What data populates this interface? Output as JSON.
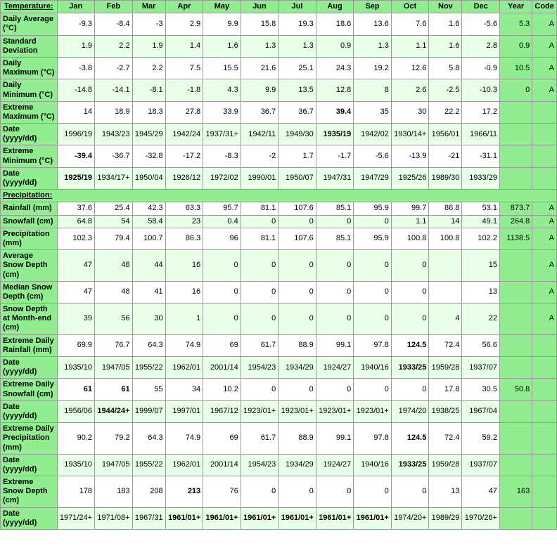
{
  "headers": {
    "label": "Temperature:",
    "cols": [
      "Jan",
      "Feb",
      "Mar",
      "Apr",
      "May",
      "Jun",
      "Jul",
      "Aug",
      "Sep",
      "Oct",
      "Nov",
      "Dec",
      "Year",
      "Code"
    ]
  },
  "rows": [
    {
      "label": "Daily Average (°C)",
      "values": [
        "-9.3",
        "-8.4",
        "-3",
        "2.9",
        "9.9",
        "15.8",
        "19.3",
        "18.6",
        "13.6",
        "7.6",
        "1.6",
        "-5.6",
        "5.3",
        "A"
      ],
      "bolds": []
    },
    {
      "label": "Standard Deviation",
      "values": [
        "1.9",
        "2.2",
        "1.9",
        "1.4",
        "1.6",
        "1.3",
        "1.3",
        "0.9",
        "1.3",
        "1.1",
        "1.6",
        "2.8",
        "0.9",
        "A"
      ],
      "bolds": []
    },
    {
      "label": "Daily Maximum (°C)",
      "values": [
        "-3.8",
        "-2.7",
        "2.2",
        "7.5",
        "15.5",
        "21.6",
        "25.1",
        "24.3",
        "19.2",
        "12.6",
        "5.8",
        "-0.9",
        "10.5",
        "A"
      ],
      "bolds": []
    },
    {
      "label": "Daily Minimum (°C)",
      "values": [
        "-14.8",
        "-14.1",
        "-8.1",
        "-1.8",
        "4.3",
        "9.9",
        "13.5",
        "12.8",
        "8",
        "2.6",
        "-2.5",
        "-10.3",
        "0",
        "A"
      ],
      "bolds": []
    },
    {
      "label": "Extreme Maximum (°C)",
      "values": [
        "14",
        "18.9",
        "18.3",
        "27.8",
        "33.9",
        "36.7",
        "36.7",
        "39.4",
        "35",
        "30",
        "22.2",
        "17.2",
        "",
        ""
      ],
      "bolds": [
        "39.4"
      ]
    },
    {
      "label": "Date (yyyy/dd)",
      "values": [
        "1996/19",
        "1943/23",
        "1945/29",
        "1942/24",
        "1937/31+",
        "1942/11",
        "1949/30",
        "1935/19",
        "1942/02",
        "1930/14+",
        "1956/01",
        "1966/11",
        "",
        ""
      ],
      "bolds": [
        "1935/19"
      ]
    },
    {
      "label": "Extreme Minimum (°C)",
      "values": [
        "-39.4",
        "-36.7",
        "-32.8",
        "-17.2",
        "-8.3",
        "-2",
        "1.7",
        "-1.7",
        "-5.6",
        "-13.9",
        "-21",
        "-31.1",
        "",
        ""
      ],
      "bolds": [
        "-39.4"
      ]
    },
    {
      "label": "Date (yyyy/dd)",
      "values": [
        "1925/19",
        "1934/17+",
        "1950/04",
        "1926/12",
        "1972/02",
        "1990/01",
        "1950/07",
        "1947/31",
        "1947/29",
        "1925/26",
        "1989/30",
        "1933/29",
        "",
        ""
      ],
      "bolds": [
        "1925/19"
      ]
    },
    {
      "section": "Precipitation:"
    },
    {
      "label": "Rainfall (mm)",
      "values": [
        "37.6",
        "25.4",
        "42.3",
        "63.3",
        "95.7",
        "81.1",
        "107.6",
        "85.1",
        "95.9",
        "99.7",
        "86.8",
        "53.1",
        "873.7",
        "A"
      ],
      "bolds": []
    },
    {
      "label": "Snowfall (cm)",
      "values": [
        "64.8",
        "54",
        "58.4",
        "23",
        "0.4",
        "0",
        "0",
        "0",
        "0",
        "1.1",
        "14",
        "49.1",
        "264.8",
        "A"
      ],
      "bolds": []
    },
    {
      "label": "Precipitation (mm)",
      "values": [
        "102.3",
        "79.4",
        "100.7",
        "86.3",
        "96",
        "81.1",
        "107.6",
        "85.1",
        "95.9",
        "100.8",
        "100.8",
        "102.2",
        "1138.5",
        "A"
      ],
      "bolds": []
    },
    {
      "label": "Average Snow Depth (cm)",
      "values": [
        "47",
        "48",
        "44",
        "16",
        "0",
        "0",
        "0",
        "0",
        "0",
        "0",
        "",
        "15",
        "",
        "A"
      ],
      "bolds": []
    },
    {
      "label": "Median Snow Depth (cm)",
      "values": [
        "47",
        "48",
        "41",
        "16",
        "0",
        "0",
        "0",
        "0",
        "0",
        "0",
        "",
        "13",
        "",
        "A"
      ],
      "bolds": []
    },
    {
      "label": "Snow Depth at Month-end (cm)",
      "values": [
        "39",
        "56",
        "30",
        "1",
        "0",
        "0",
        "0",
        "0",
        "0",
        "0",
        "4",
        "22",
        "",
        "A"
      ],
      "bolds": []
    },
    {
      "label": "Extreme Daily Rainfall (mm)",
      "values": [
        "69.9",
        "76.7",
        "64.3",
        "74.9",
        "69",
        "61.7",
        "88.9",
        "99.1",
        "97.8",
        "124.5",
        "72.4",
        "56.6",
        "",
        ""
      ],
      "bolds": [
        "124.5"
      ]
    },
    {
      "label": "Date (yyyy/dd)",
      "values": [
        "1935/10",
        "1947/05",
        "1955/22",
        "1962/01",
        "2001/14",
        "1954/23",
        "1934/29",
        "1924/27",
        "1940/16",
        "1933/25",
        "1959/28",
        "1937/07",
        "",
        ""
      ],
      "bolds": [
        "1933/25"
      ]
    },
    {
      "label": "Extreme Daily Snowfall (cm)",
      "values": [
        "61",
        "61",
        "55",
        "34",
        "10.2",
        "0",
        "0",
        "0",
        "0",
        "0",
        "17.8",
        "30.5",
        "50.8",
        ""
      ],
      "bolds": [
        "61"
      ]
    },
    {
      "label": "Date (yyyy/dd)",
      "values": [
        "1956/06",
        "1944/24+",
        "1999/07",
        "1997/01",
        "1967/12",
        "1923/01+",
        "1923/01+",
        "1923/01+",
        "1923/01+",
        "1974/20",
        "1938/25",
        "1967/04",
        "",
        ""
      ],
      "bolds": [
        "1944/24+"
      ]
    },
    {
      "label": "Extreme Daily Precipitation (mm)",
      "values": [
        "90.2",
        "79.2",
        "64.3",
        "74.9",
        "69",
        "61.7",
        "88.9",
        "99.1",
        "97.8",
        "124.5",
        "72.4",
        "59.2",
        "",
        ""
      ],
      "bolds": [
        "124.5"
      ]
    },
    {
      "label": "Date (yyyy/dd)",
      "values": [
        "1935/10",
        "1947/05",
        "1955/22",
        "1962/01",
        "2001/14",
        "1954/23",
        "1934/29",
        "1924/27",
        "1940/16",
        "1933/25",
        "1959/28",
        "1937/07",
        "",
        ""
      ],
      "bolds": [
        "1933/25"
      ]
    },
    {
      "label": "Extreme Snow Depth (cm)",
      "values": [
        "178",
        "183",
        "208",
        "213",
        "76",
        "0",
        "0",
        "0",
        "0",
        "0",
        "13",
        "47",
        "163",
        ""
      ],
      "bolds": [
        "213"
      ]
    },
    {
      "label": "Date (yyyy/dd)",
      "values": [
        "1971/24+",
        "1971/08+",
        "1967/31",
        "1961/01+",
        "1961/01+",
        "1961/01+",
        "1961/01+",
        "1961/01+",
        "1961/01+",
        "1974/20+",
        "1989/29",
        "1970/26+",
        "",
        ""
      ],
      "bolds": [
        "1961/01+"
      ]
    }
  ]
}
